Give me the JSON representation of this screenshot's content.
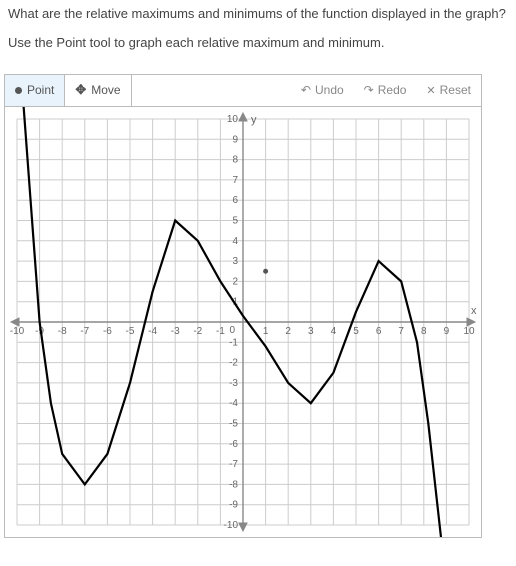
{
  "question": "What are the relative maximums and minimums of the function displayed in the graph?",
  "instruction": "Use the Point tool to graph each relative maximum and minimum.",
  "toolbar": {
    "point": "Point",
    "move": "Move",
    "undo": "Undo",
    "redo": "Redo",
    "reset": "Reset"
  },
  "chart_data": {
    "type": "line",
    "xlabel": "x",
    "ylabel": "y",
    "xlim": [
      -10,
      10
    ],
    "ylim": [
      -10,
      10
    ],
    "x_ticks": [
      -10,
      -9,
      -8,
      -7,
      -6,
      -5,
      -4,
      -3,
      -2,
      -1,
      0,
      1,
      2,
      3,
      4,
      5,
      6,
      7,
      8,
      9,
      10
    ],
    "y_ticks": [
      -10,
      -9,
      -8,
      -7,
      -6,
      -5,
      -4,
      -3,
      -2,
      -1,
      1,
      2,
      3,
      4,
      5,
      6,
      7,
      8,
      9,
      10
    ],
    "relative_maxima": [
      {
        "x": -3,
        "y": 5
      },
      {
        "x": 6,
        "y": 3
      }
    ],
    "relative_minima": [
      {
        "x": -7,
        "y": -8
      },
      {
        "x": 3,
        "y": -4
      }
    ],
    "plotted_points": [
      {
        "x": 1,
        "y": 2.5
      }
    ],
    "curve_description": "Polynomial-like curve descending from upper-left, through local min at (-7,-8), local max at (-3,5), crossing near x=0 slightly above 0, local min at (3,-4), local max at (6,3), then descending steeply off bottom-right."
  }
}
